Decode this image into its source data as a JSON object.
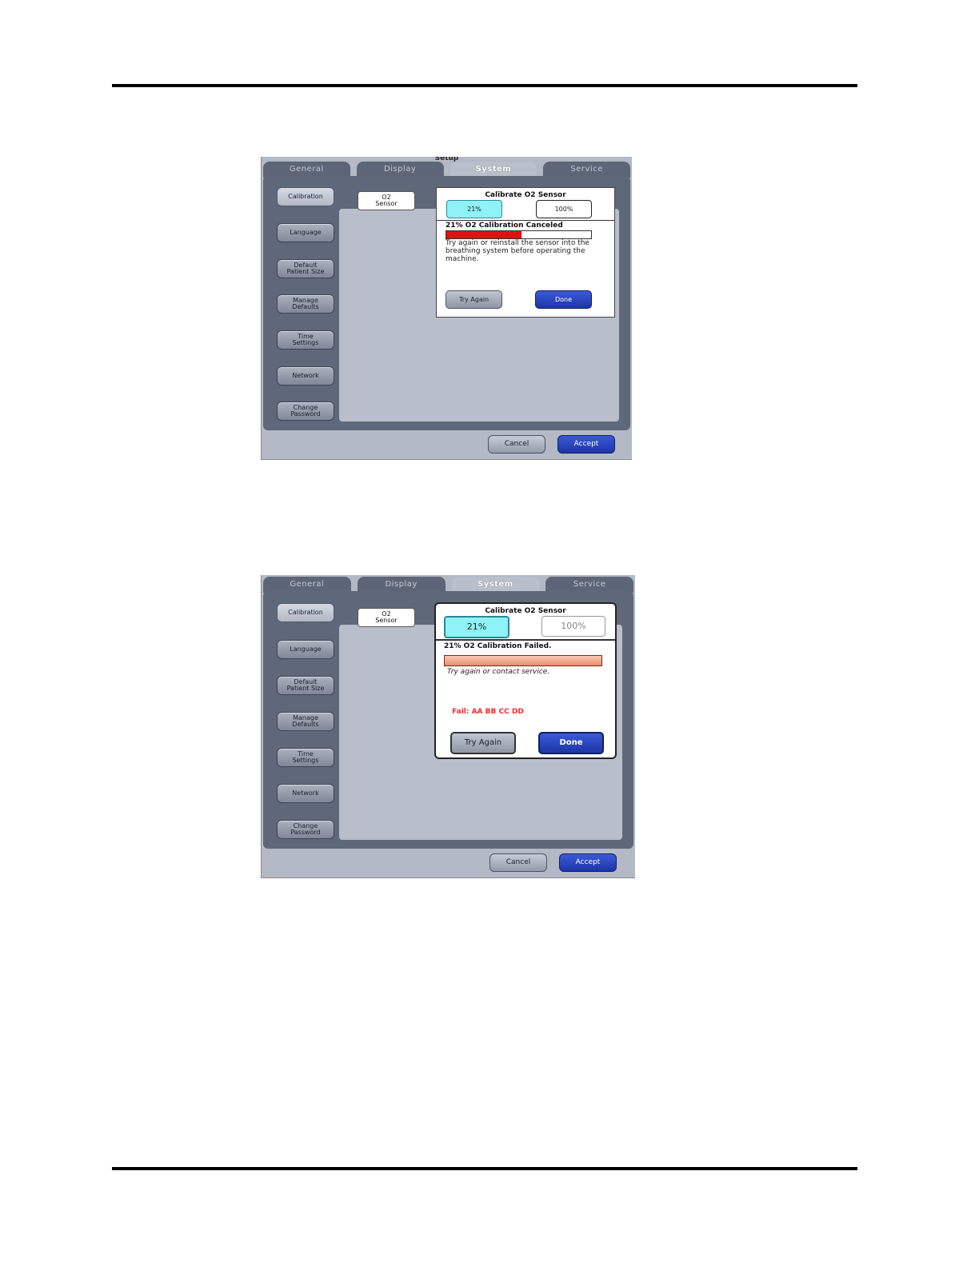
{
  "screen1": {
    "header_title": "Setup",
    "tabs": [
      "General",
      "Display",
      "System",
      "Service"
    ],
    "active_tab": "System",
    "side_buttons": [
      "Calibration",
      "Language",
      "Default\nPatient Size",
      "Manage\nDefaults",
      "Time\nSettings",
      "Network",
      "Change\nPassword"
    ],
    "sensor_button": "O2\nSensor",
    "dialog": {
      "title": "Calibrate O2 Sensor",
      "pct_21": "21%",
      "pct_100": "100%",
      "status": "21% O2 Calibration Canceled",
      "progress_fraction": 0.52,
      "message": "Try again or reinstall the sensor into the breathing system before operating the machine.",
      "try_again": "Try Again",
      "done": "Done"
    },
    "footer": {
      "cancel": "Cancel",
      "accept": "Accept"
    }
  },
  "screen2": {
    "tabs": [
      "General",
      "Display",
      "System",
      "Service"
    ],
    "active_tab": "System",
    "side_buttons": [
      "Calibration",
      "Language",
      "Default\nPatient Size",
      "Manage\nDefaults",
      "Time\nSettings",
      "Network",
      "Change\nPassword"
    ],
    "sensor_button": "O2\nSensor",
    "dialog": {
      "title": "Calibrate O2 Sensor",
      "pct_21": "21%",
      "pct_100": "100%",
      "status": "21% O2 Calibration Failed.",
      "progress_fraction": 1.0,
      "message": "Try again or contact service.",
      "fail_code": "Fail: AA BB CC DD",
      "try_again": "Try Again",
      "done": "Done"
    },
    "footer": {
      "cancel": "Cancel",
      "accept": "Accept"
    }
  },
  "colors": {
    "accent_blue": "#1d36a6",
    "selected_cyan": "#8ef2f7",
    "error_red": "#e01111",
    "fail_text": "#ff2a2a"
  }
}
